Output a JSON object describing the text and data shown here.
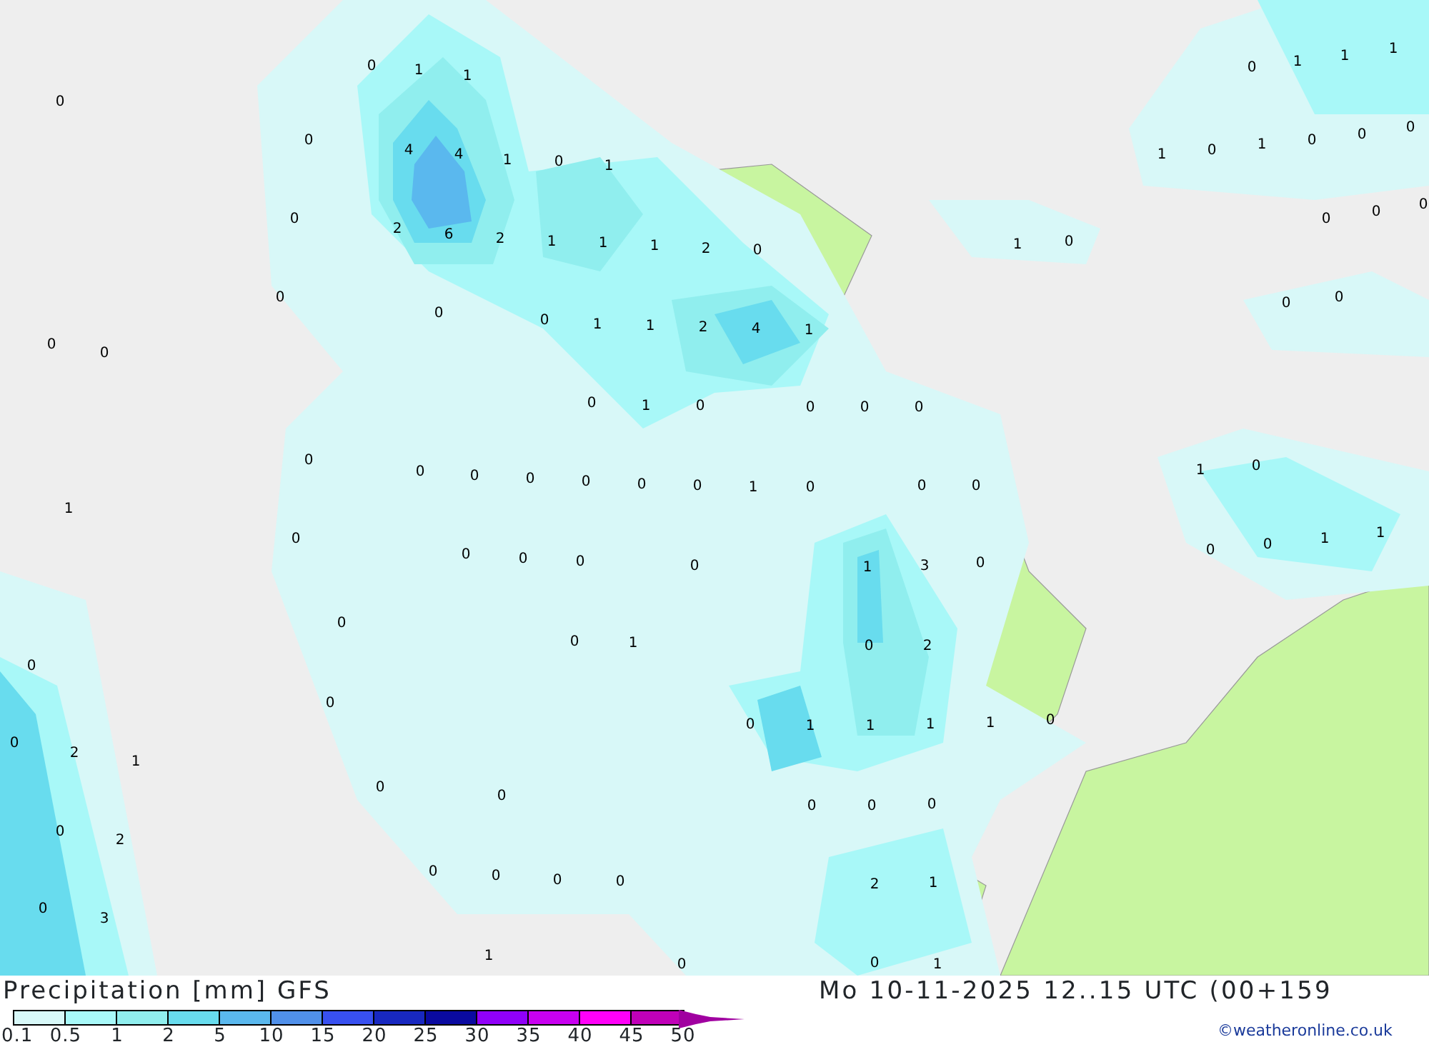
{
  "map": {
    "contour_labels": [
      "0",
      "1",
      "1",
      "0",
      "0",
      "4",
      "4",
      "1",
      "0",
      "1",
      "0",
      "2",
      "6",
      "2",
      "1",
      "1",
      "1",
      "2",
      "0",
      "0",
      "0",
      "0",
      "1",
      "1",
      "2",
      "4",
      "1",
      "0",
      "0",
      "0",
      "1",
      "0",
      "0",
      "0",
      "0",
      "0",
      "0",
      "0",
      "0",
      "0",
      "0",
      "0",
      "1",
      "0",
      "0",
      "0",
      "1",
      "0",
      "0",
      "0",
      "0",
      "0",
      "1",
      "3",
      "0",
      "0",
      "0",
      "1",
      "0",
      "2",
      "0",
      "0",
      "0",
      "2",
      "1",
      "0",
      "1",
      "1",
      "1",
      "1",
      "0",
      "0",
      "0",
      "0",
      "2",
      "0",
      "0",
      "0",
      "0",
      "0",
      "0",
      "0",
      "0",
      "3",
      "2",
      "1",
      "1",
      "0",
      "0",
      "1",
      "0",
      "1",
      "1",
      "1",
      "1",
      "0",
      "1",
      "0",
      "0",
      "0",
      "1",
      "0",
      "0",
      "0",
      "0",
      "0",
      "0",
      "1",
      "0",
      "0",
      "0",
      "1",
      "1"
    ]
  },
  "footer": {
    "title": "Precipitation [mm] GFS",
    "datetime": "Mo 10-11-2025 12..15 UTC (00+159",
    "credit": "©weatheronline.co.uk",
    "legend": [
      {
        "label": "0.1",
        "color": "#d8f8f8"
      },
      {
        "label": "0.5",
        "color": "#a8f8f8"
      },
      {
        "label": "1",
        "color": "#90eeee"
      },
      {
        "label": "2",
        "color": "#68dcee"
      },
      {
        "label": "5",
        "color": "#5ab8ee"
      },
      {
        "label": "10",
        "color": "#5090ea"
      },
      {
        "label": "15",
        "color": "#3850f0"
      },
      {
        "label": "20",
        "color": "#1828c0"
      },
      {
        "label": "25",
        "color": "#0a0aa0"
      },
      {
        "label": "30",
        "color": "#9000f8"
      },
      {
        "label": "35",
        "color": "#c800f0"
      },
      {
        "label": "40",
        "color": "#ff00f8"
      },
      {
        "label": "45",
        "color": "#c000b8"
      },
      {
        "label": "50",
        "color": "#a000a0"
      }
    ]
  }
}
